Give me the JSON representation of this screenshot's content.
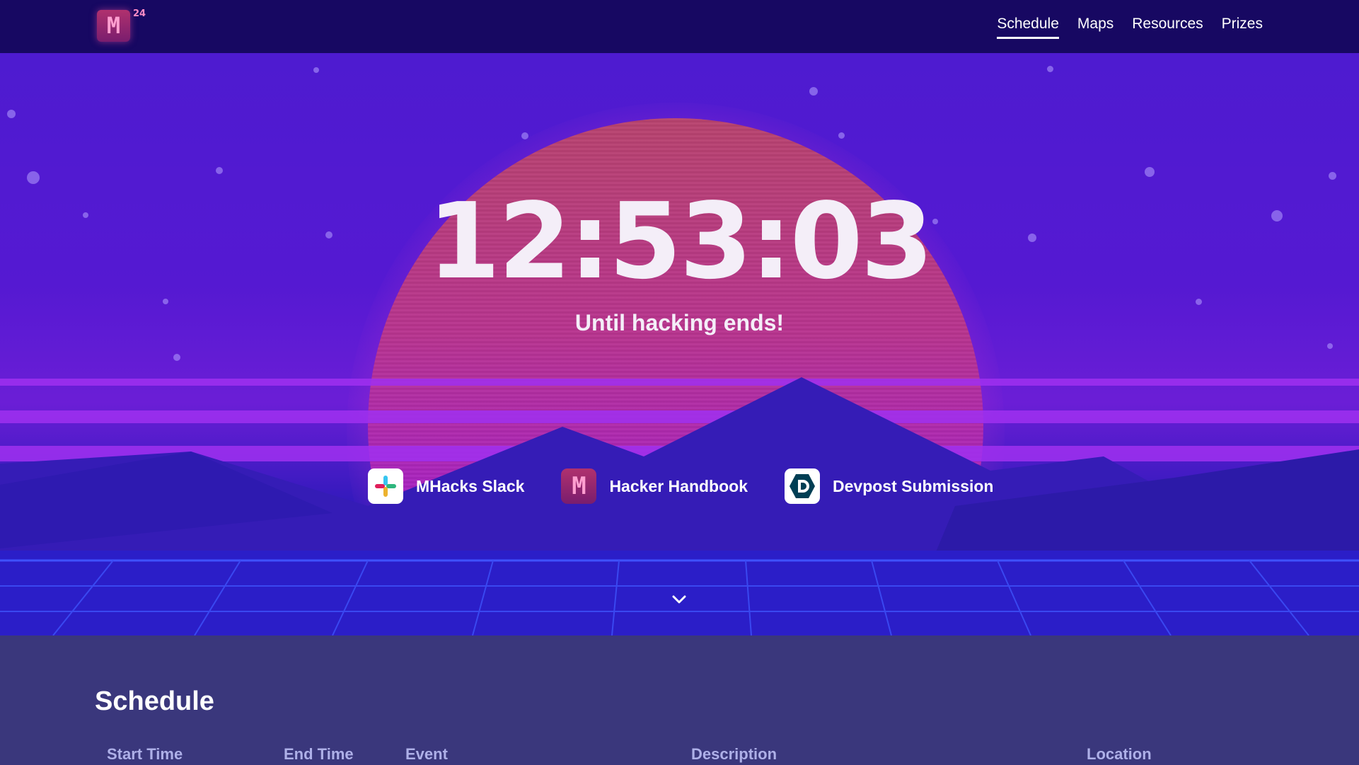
{
  "nav": {
    "logo_letter": "M",
    "logo_sup": "24",
    "links": [
      {
        "label": "Schedule",
        "active": true
      },
      {
        "label": "Maps",
        "active": false
      },
      {
        "label": "Resources",
        "active": false
      },
      {
        "label": "Prizes",
        "active": false
      }
    ]
  },
  "hero": {
    "countdown": "12:53:03",
    "subtitle": "Until hacking ends!",
    "links": [
      {
        "label": "MHacks Slack",
        "icon": "slack-icon"
      },
      {
        "label": "Hacker Handbook",
        "icon": "mhacks-logo-icon"
      },
      {
        "label": "Devpost Submission",
        "icon": "devpost-icon"
      }
    ],
    "scroll_icon": "chevron-down-icon"
  },
  "schedule": {
    "title": "Schedule",
    "columns": [
      "Start Time",
      "End Time",
      "Event",
      "Description",
      "Location"
    ]
  },
  "colors": {
    "nav_bg": "#170862",
    "sun_top": "#b8436e",
    "schedule_bg": "#3a377c",
    "column_header": "#aeb0e8"
  }
}
